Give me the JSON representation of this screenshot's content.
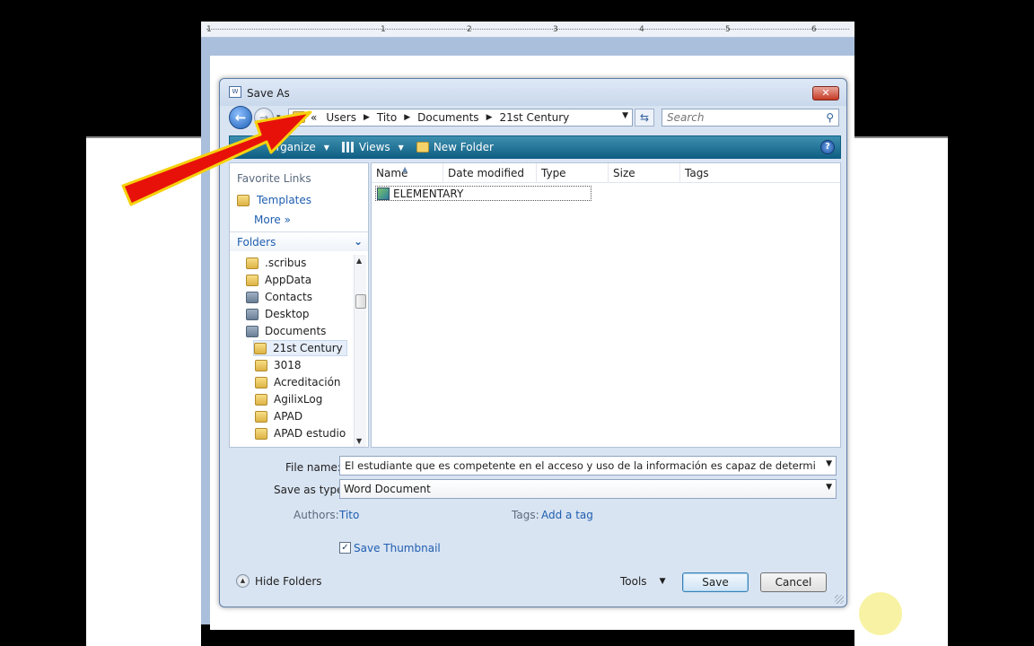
{
  "ruler": {
    "ticks": [
      "1",
      "1",
      "2",
      "3",
      "4",
      "5",
      "6"
    ]
  },
  "dialog": {
    "title": "Save As",
    "title_icon_text": "W",
    "close_glyph": "✕"
  },
  "address": {
    "prefix": "«",
    "crumbs": [
      "Users",
      "Tito",
      "Documents",
      "21st Century"
    ]
  },
  "search": {
    "placeholder": "Search"
  },
  "toolbar": {
    "organize_label": "Organize",
    "views_label": "Views",
    "new_folder_label": "New Folder",
    "help_glyph": "?"
  },
  "nav": {
    "favorites_header": "Favorite Links",
    "favorites": [
      "Templates"
    ],
    "more_label": "More »",
    "folders_label": "Folders",
    "tree": [
      {
        "label": ".scribus",
        "dark": false
      },
      {
        "label": "AppData",
        "dark": false
      },
      {
        "label": "Contacts",
        "dark": true
      },
      {
        "label": "Desktop",
        "dark": true
      },
      {
        "label": "Documents",
        "dark": true
      },
      {
        "label": "21st Century",
        "dark": false
      },
      {
        "label": "3018",
        "dark": false
      },
      {
        "label": "Acreditación",
        "dark": false
      },
      {
        "label": "AgilixLog",
        "dark": false
      },
      {
        "label": "APAD",
        "dark": false
      },
      {
        "label": "APAD estudio",
        "dark": false
      }
    ]
  },
  "files": {
    "columns": [
      "Name",
      "Date modified",
      "Type",
      "Size",
      "Tags"
    ],
    "rows": [
      {
        "name": "ELEMENTARY"
      }
    ]
  },
  "form": {
    "filename_label": "File name:",
    "filename_value": "El estudiante que es competente en el acceso y uso de la información es capaz de determinar la natu",
    "savetype_label": "Save as type:",
    "savetype_value": "Word Document",
    "authors_label": "Authors:",
    "authors_value": "Tito",
    "tags_label": "Tags:",
    "tags_value": "Add a tag",
    "thumbnail_label": "Save Thumbnail",
    "thumbnail_checked": true
  },
  "footer": {
    "hide_folders_label": "Hide Folders",
    "tools_label": "Tools",
    "save_label": "Save",
    "cancel_label": "Cancel"
  },
  "colors": {
    "toolbar": "#0f5f84",
    "link": "#1f5eb0",
    "arrow_fill": "#e8110a",
    "arrow_outline": "#f6d10d"
  }
}
